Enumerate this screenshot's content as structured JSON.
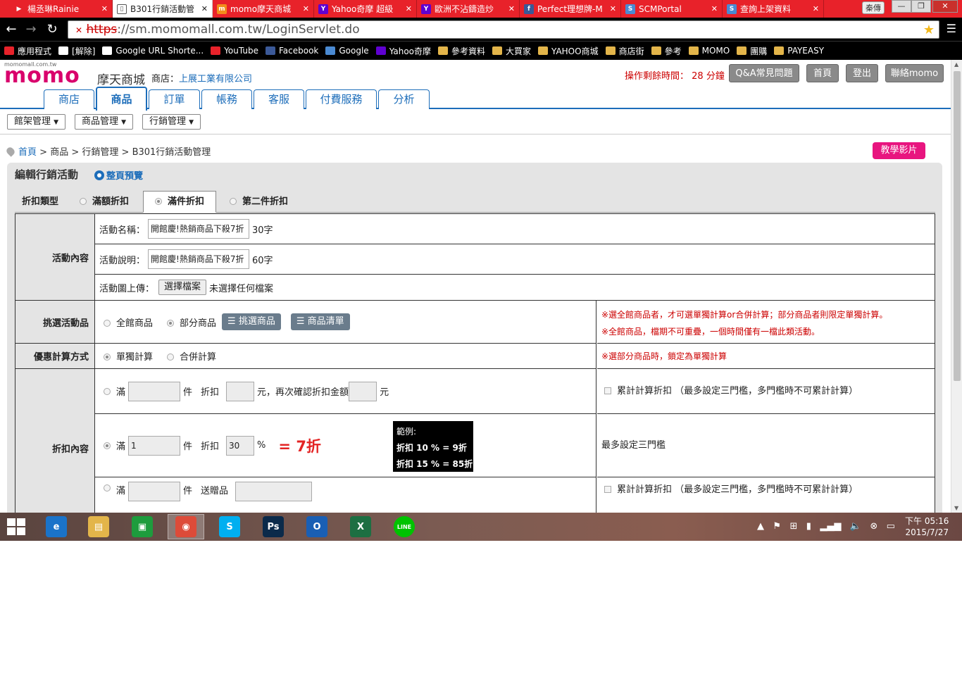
{
  "browser": {
    "tabs": [
      {
        "title": "楊丞琳Rainie",
        "fav_color": "#e8222a",
        "fav": "▶"
      },
      {
        "title": "B301行銷活動管",
        "fav_color": "#555555",
        "fav": "▯"
      },
      {
        "title": "momo摩天商城",
        "fav_color": "#f28c1b",
        "fav": "m"
      },
      {
        "title": "Yahoo奇摩 超級",
        "fav_color": "#5f01d1",
        "fav": "Y"
      },
      {
        "title": "歐洲不沾鑄造炒",
        "fav_color": "#5f01d1",
        "fav": "Y"
      },
      {
        "title": "Perfect理想牌-M",
        "fav_color": "#3b5998",
        "fav": "f"
      },
      {
        "title": "SCMPortal",
        "fav_color": "#4a8ad2",
        "fav": "S"
      },
      {
        "title": "查詢上架資料",
        "fav_color": "#4a8ad2",
        "fav": "S"
      }
    ],
    "user": "秦傳",
    "url_scheme": "https",
    "url_rest": "://sm.momomall.com.tw/LoginServlet.do",
    "bookmarks": [
      {
        "label": "應用程式",
        "color": "#e8222a"
      },
      {
        "label": "[解除]",
        "color": "#ffffff"
      },
      {
        "label": "Google URL Shorte...",
        "color": "#ffffff"
      },
      {
        "label": "YouTube",
        "color": "#e8222a"
      },
      {
        "label": "Facebook",
        "color": "#3b5998"
      },
      {
        "label": "Google",
        "color": "#4a8ad2"
      },
      {
        "label": "Yahoo奇摩",
        "color": "#5f01d1"
      },
      {
        "label": "參考資料",
        "color": "#e3b54a"
      },
      {
        "label": "大買家",
        "color": "#e3b54a"
      },
      {
        "label": "YAHOO商城",
        "color": "#e3b54a"
      },
      {
        "label": "商店街",
        "color": "#e3b54a"
      },
      {
        "label": "參考",
        "color": "#e3b54a"
      },
      {
        "label": "MOMO",
        "color": "#e3b54a"
      },
      {
        "label": "團購",
        "color": "#e3b54a"
      },
      {
        "label": "PAYEASY",
        "color": "#e3b54a"
      }
    ]
  },
  "header": {
    "domain": "momomall.com.tw",
    "logo": "momo",
    "site_title": "摩天商城",
    "shop_label": "商店：",
    "shop_name": "上展工業有限公司",
    "timer_label": "操作剩餘時間：",
    "timer_value": "28 分鐘",
    "buttons": [
      "Q&A常見問題",
      "首頁",
      "登出",
      "聯絡momo"
    ]
  },
  "main_tabs": [
    "商店",
    "商品",
    "訂單",
    "帳務",
    "客服",
    "付費服務",
    "分析"
  ],
  "active_tab": "商品",
  "sub_menus": [
    "館架管理",
    "商品管理",
    "行銷管理"
  ],
  "breadcrumb": [
    "首頁",
    "商品",
    "行銷管理",
    "B301行銷活動管理"
  ],
  "teach_button": "教學影片",
  "panel": {
    "title": "編輯行銷活動",
    "preview": "整頁預覽"
  },
  "discount_types": {
    "label": "折扣類型",
    "options": [
      "滿額折扣",
      "滿件折扣",
      "第二件折扣"
    ],
    "selected": "滿件折扣"
  },
  "activity": {
    "label": "活動內容",
    "name_label": "活動名稱：",
    "name_value": "開館慶!熱銷商品下殺7折",
    "name_limit": "30字",
    "desc_label": "活動說明：",
    "desc_value": "開館慶!熱銷商品下殺7折",
    "desc_limit": "60字",
    "image_label": "活動圖上傳：",
    "file_button": "選擇檔案",
    "file_status": "未選擇任何檔案"
  },
  "select_products": {
    "label": "挑選活動品",
    "options": [
      "全館商品",
      "部分商品"
    ],
    "selected": "部分商品",
    "pick_button": "挑選商品",
    "list_button": "商品清單",
    "note1": "※選全館商品者，才可選單獨計算or合併計算；部分商品者則限定單獨計算。",
    "note2": "※全館商品，檔期不可重疊，一個時間僅有一檔此類活動。"
  },
  "calc": {
    "label": "優惠計算方式",
    "options": [
      "單獨計算",
      "合併計算"
    ],
    "selected": "單獨計算",
    "note": "※選部分商品時，鎖定為單獨計算"
  },
  "discount": {
    "label": "折扣內容",
    "row1": {
      "man": "滿",
      "jian": "件",
      "zhekou": "折扣",
      "mid": "元，再次確認折扣金額",
      "yuan": "元",
      "cumulative": "累計計算折扣 （最多設定三門檻，多門檻時不可累計計算）"
    },
    "row2": {
      "man": "滿",
      "qty": "1",
      "jian": "件",
      "zhekou": "折扣",
      "pct": "30",
      "pct_unit": "%",
      "result": "= 7折",
      "note": "最多設定三門檻"
    },
    "example": {
      "title": "範例:",
      "line1": "折扣 10 % = 9折",
      "line2": "折扣 15 % = 85折"
    },
    "row3": {
      "man": "滿",
      "jian": "件",
      "gift": "送贈品",
      "cumulative": "累計計算折扣 （最多設定三門檻，多門檻時不可累計計算）"
    }
  },
  "taskbar": {
    "time": "下午 05:16",
    "date": "2015/7/27",
    "apps": [
      {
        "name": "IE",
        "color": "#1a73c9",
        "glyph": "e"
      },
      {
        "name": "Explorer",
        "color": "#e3b54a",
        "glyph": "▤"
      },
      {
        "name": "Store",
        "color": "#1e9c3d",
        "glyph": "▣"
      },
      {
        "name": "Chrome",
        "color": "#dd4b39",
        "glyph": "◉"
      },
      {
        "name": "Skype",
        "color": "#00aff0",
        "glyph": "S"
      },
      {
        "name": "Photoshop",
        "color": "#0b2a4a",
        "glyph": "Ps"
      },
      {
        "name": "Outlook",
        "color": "#1a5fb4",
        "glyph": "O"
      },
      {
        "name": "Excel",
        "color": "#1d6f42",
        "glyph": "X"
      },
      {
        "name": "LINE",
        "color": "#00c300",
        "glyph": "LINE"
      }
    ]
  }
}
